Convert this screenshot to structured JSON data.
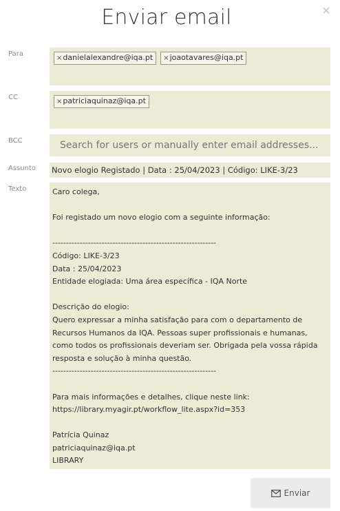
{
  "dialog": {
    "title": "Enviar email",
    "close_icon": "close-icon"
  },
  "to": {
    "label": "Para",
    "recipients": [
      "danielalexandre@iqa.pt",
      "joaotavares@iqa.pt"
    ]
  },
  "cc": {
    "label": "CC",
    "recipients": [
      "patriciaquinaz@iqa.pt"
    ]
  },
  "bcc": {
    "label": "BCC",
    "placeholder": "Search for users or manually enter email addresses...",
    "value": ""
  },
  "subject": {
    "label": "Assunto",
    "value": "Novo elogio Registado  | Data : 25/04/2023  | Código: LIKE-3/23"
  },
  "body": {
    "label": "Texto",
    "value": "Caro colega,\n\nFoi registado um novo elogio com a seguinte informação:\n\n------------------------------------------------------------\nCódigo: LIKE-3/23\nData : 25/04/2023\nEntidade elogiada: Uma área específica - IQA Norte\n\nDescrição do elogio:\nQuero expressar a minha satisfação para com o departamento de Recursos Humanos da IQA. Pessoas super profissionais e humanas, como todos os profissionais deveriam ser. Obrigada pela vossa rápida resposta e solução à minha questão.\n------------------------------------------------------------\n\nPara mais informações e detalhes, clique neste link:\nhttps://library.myagir.pt/workflow_lite.aspx?id=353\n\nPatrícia Quinaz\npatriciaquinaz@iqa.pt\nLIBRARY"
  },
  "send_button": {
    "label": "Enviar",
    "icon": "envelope-icon"
  },
  "colors": {
    "field_background": "#ebebd6",
    "button_background": "#ececec"
  }
}
